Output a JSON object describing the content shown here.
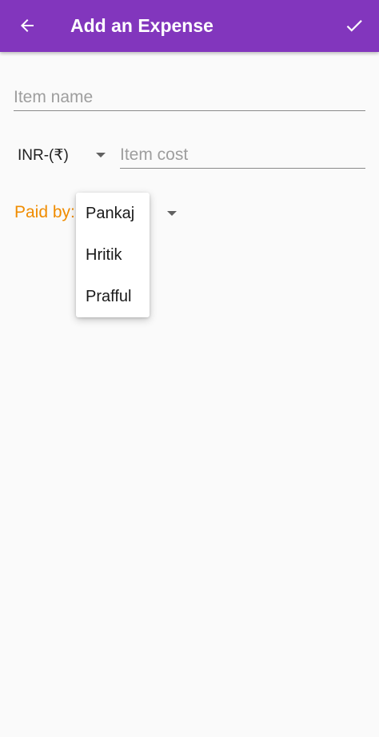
{
  "app_bar": {
    "title": "Add an Expense",
    "background_color": "#8236bd",
    "back_icon": "arrow-left-icon",
    "confirm_icon": "check-icon"
  },
  "form": {
    "item_name": {
      "value": "",
      "placeholder": "Item name"
    },
    "currency": {
      "selected": "INR-(₹)"
    },
    "item_cost": {
      "value": "",
      "placeholder": "Item cost"
    },
    "paid_by": {
      "label": "Paid by:",
      "label_color": "#f08c00",
      "options": [
        "Pankaj",
        "Hritik",
        "Prafful"
      ]
    }
  }
}
